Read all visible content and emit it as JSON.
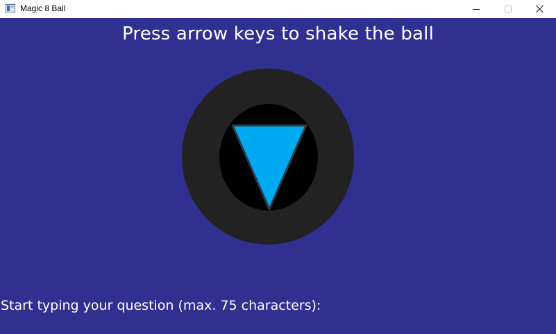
{
  "window": {
    "title": "Magic 8 Ball",
    "icon": "app-window-icon",
    "controls": [
      "minimize",
      "maximize",
      "close"
    ]
  },
  "game": {
    "instruction": "Press arrow keys to shake the ball",
    "question_prompt": "Start typing your question (max. 75 characters):",
    "question_text": "",
    "colors": {
      "background": "#303090",
      "ball_outer": "#222222",
      "ball_window": "#000000",
      "triangle": "#00aaf0",
      "triangle_edge": "#2a3a4a",
      "text": "#ffffff"
    }
  }
}
